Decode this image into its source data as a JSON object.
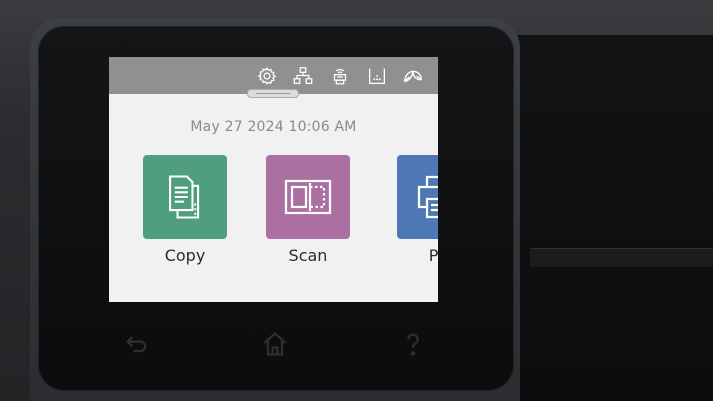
{
  "status_bar": {
    "icons": [
      "settings-icon",
      "network-icon",
      "wireless-direct-icon",
      "supplies-icon",
      "eco-leaf-icon"
    ]
  },
  "home": {
    "datetime": "May 27 2024 10:06 AM",
    "apps": [
      {
        "label": "Copy",
        "icon": "copy-icon",
        "color": "#4f9e7f"
      },
      {
        "label": "Scan",
        "icon": "scan-icon",
        "color": "#ac6fa2"
      },
      {
        "label": "Pri",
        "icon": "print-icon",
        "color": "#4e78b5"
      }
    ]
  },
  "hardware_buttons": [
    "back-icon",
    "home-icon",
    "help-icon"
  ]
}
